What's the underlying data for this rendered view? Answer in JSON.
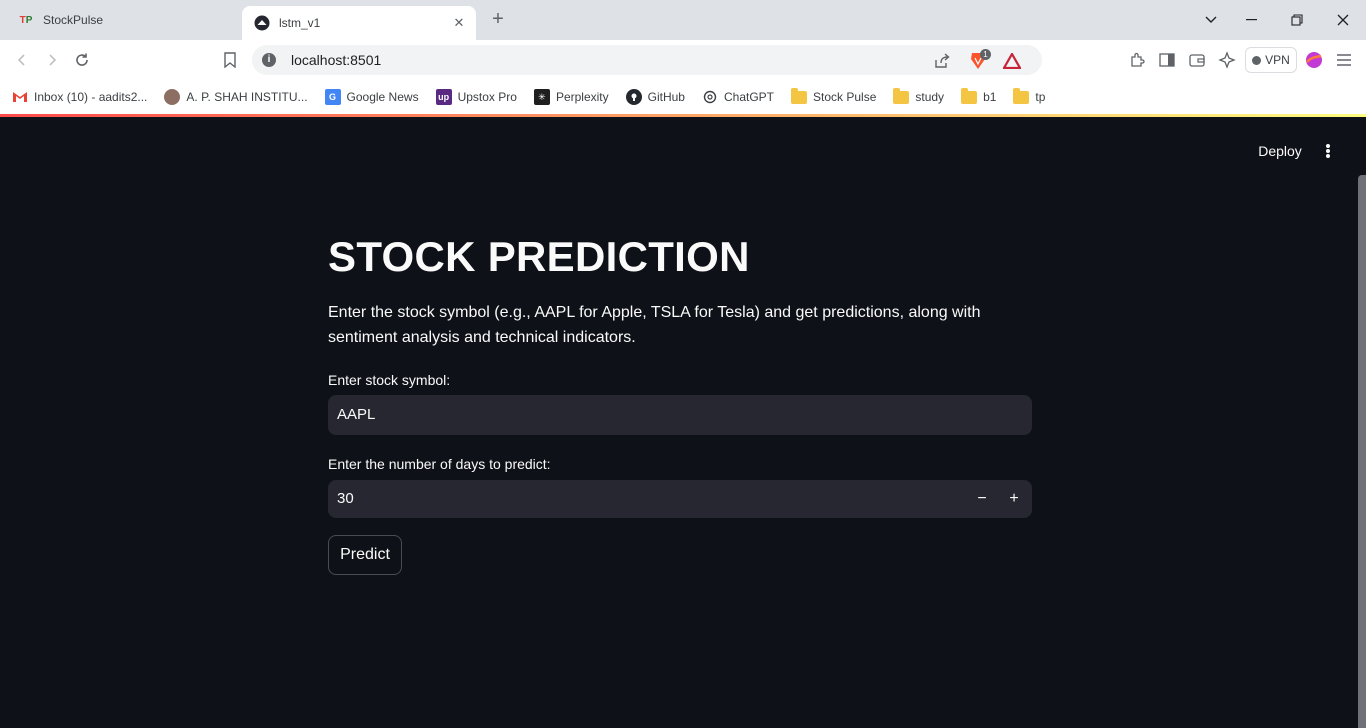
{
  "tabs": [
    {
      "title": "StockPulse",
      "icon": "tp-logo-icon"
    },
    {
      "title": "lstm_v1",
      "icon": "streamlit-icon"
    }
  ],
  "toolbar": {
    "url": "localhost:8501",
    "vpn_label": "VPN",
    "brave_badge": "1"
  },
  "bookmarks": [
    {
      "label": "Inbox (10) - aadits2...",
      "icon": "gmail-icon"
    },
    {
      "label": "A. P. SHAH INSTITU...",
      "icon": "apsit-icon"
    },
    {
      "label": "Google News",
      "icon": "google-news-icon"
    },
    {
      "label": "Upstox Pro",
      "icon": "upstox-icon"
    },
    {
      "label": "Perplexity",
      "icon": "perplexity-icon"
    },
    {
      "label": "GitHub",
      "icon": "github-icon"
    },
    {
      "label": "ChatGPT",
      "icon": "chatgpt-icon"
    },
    {
      "label": "Stock Pulse",
      "icon": "folder-icon"
    },
    {
      "label": "study",
      "icon": "folder-icon"
    },
    {
      "label": "b1",
      "icon": "folder-icon"
    },
    {
      "label": "tp",
      "icon": "folder-icon"
    }
  ],
  "app": {
    "deploy_label": "Deploy",
    "title": "STOCK PREDICTION",
    "description": "Enter the stock symbol (e.g., AAPL for Apple, TSLA for Tesla) and get predictions, along with sentiment analysis and technical indicators.",
    "symbol_label": "Enter stock symbol:",
    "symbol_value": "AAPL",
    "days_label": "Enter the number of days to predict:",
    "days_value": "30",
    "minus": "−",
    "plus": "+",
    "predict_label": "Predict"
  },
  "colors": {
    "background": "#0e1117",
    "input_bg": "#262730",
    "text": "#fafafa"
  }
}
